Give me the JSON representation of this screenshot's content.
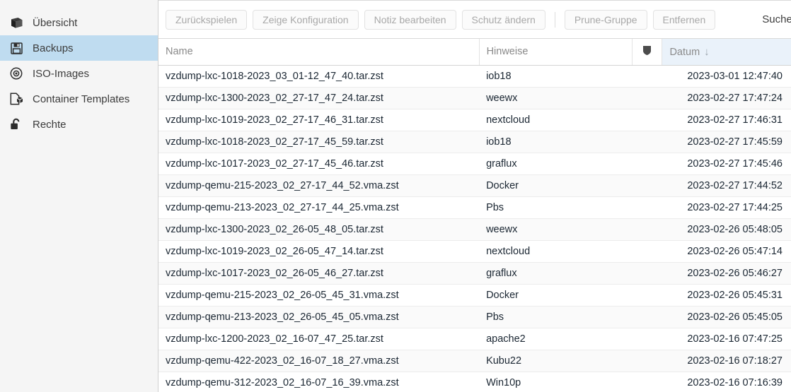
{
  "sidebar": {
    "items": [
      {
        "label": "Übersicht",
        "icon": "book-icon",
        "selected": false
      },
      {
        "label": "Backups",
        "icon": "floppy-disk-icon",
        "selected": true
      },
      {
        "label": "ISO-Images",
        "icon": "disc-icon",
        "selected": false
      },
      {
        "label": "Container Templates",
        "icon": "container-template-icon",
        "selected": false
      },
      {
        "label": "Rechte",
        "icon": "open-padlock-icon",
        "selected": false
      }
    ],
    "selected_bg": "#bfdcf0"
  },
  "toolbar": {
    "buttons": [
      {
        "label": "Zurückspielen",
        "disabled": true
      },
      {
        "label": "Zeige Konfiguration",
        "disabled": true
      },
      {
        "label": "Notiz bearbeiten",
        "disabled": true
      },
      {
        "label": "Schutz ändern",
        "disabled": true
      },
      {
        "label": "Prune-Gruppe",
        "disabled": true
      },
      {
        "label": "Entfernen",
        "disabled": true
      }
    ],
    "separator_after_index": 3,
    "search_label": "Suche:"
  },
  "grid": {
    "columns": [
      {
        "key": "name",
        "label": "Name",
        "sorted": false
      },
      {
        "key": "notes",
        "label": "Hinweise",
        "sorted": false
      },
      {
        "key": "protected",
        "label": "",
        "icon": "shield-icon",
        "sorted": false
      },
      {
        "key": "date",
        "label": "Datum",
        "sorted": true,
        "sort_direction": "desc",
        "sort_glyph": "↓"
      }
    ],
    "rows": [
      {
        "name": "vzdump-lxc-1018-2023_03_01-12_47_40.tar.zst",
        "notes": "iob18",
        "protected": "",
        "date": "2023-03-01 12:47:40"
      },
      {
        "name": "vzdump-lxc-1300-2023_02_27-17_47_24.tar.zst",
        "notes": "weewx",
        "protected": "",
        "date": "2023-02-27 17:47:24"
      },
      {
        "name": "vzdump-lxc-1019-2023_02_27-17_46_31.tar.zst",
        "notes": "nextcloud",
        "protected": "",
        "date": "2023-02-27 17:46:31"
      },
      {
        "name": "vzdump-lxc-1018-2023_02_27-17_45_59.tar.zst",
        "notes": "iob18",
        "protected": "",
        "date": "2023-02-27 17:45:59"
      },
      {
        "name": "vzdump-lxc-1017-2023_02_27-17_45_46.tar.zst",
        "notes": "graflux",
        "protected": "",
        "date": "2023-02-27 17:45:46"
      },
      {
        "name": "vzdump-qemu-215-2023_02_27-17_44_52.vma.zst",
        "notes": "Docker",
        "protected": "",
        "date": "2023-02-27 17:44:52"
      },
      {
        "name": "vzdump-qemu-213-2023_02_27-17_44_25.vma.zst",
        "notes": "Pbs",
        "protected": "",
        "date": "2023-02-27 17:44:25"
      },
      {
        "name": "vzdump-lxc-1300-2023_02_26-05_48_05.tar.zst",
        "notes": "weewx",
        "protected": "",
        "date": "2023-02-26 05:48:05"
      },
      {
        "name": "vzdump-lxc-1019-2023_02_26-05_47_14.tar.zst",
        "notes": "nextcloud",
        "protected": "",
        "date": "2023-02-26 05:47:14"
      },
      {
        "name": "vzdump-lxc-1017-2023_02_26-05_46_27.tar.zst",
        "notes": "graflux",
        "protected": "",
        "date": "2023-02-26 05:46:27"
      },
      {
        "name": "vzdump-qemu-215-2023_02_26-05_45_31.vma.zst",
        "notes": "Docker",
        "protected": "",
        "date": "2023-02-26 05:45:31"
      },
      {
        "name": "vzdump-qemu-213-2023_02_26-05_45_05.vma.zst",
        "notes": "Pbs",
        "protected": "",
        "date": "2023-02-26 05:45:05"
      },
      {
        "name": "vzdump-lxc-1200-2023_02_16-07_47_25.tar.zst",
        "notes": "apache2",
        "protected": "",
        "date": "2023-02-16 07:47:25"
      },
      {
        "name": "vzdump-qemu-422-2023_02_16-07_18_27.vma.zst",
        "notes": "Kubu22",
        "protected": "",
        "date": "2023-02-16 07:18:27"
      },
      {
        "name": "vzdump-qemu-312-2023_02_16-07_16_39.vma.zst",
        "notes": "Win10p",
        "protected": "",
        "date": "2023-02-16 07:16:39"
      }
    ]
  }
}
